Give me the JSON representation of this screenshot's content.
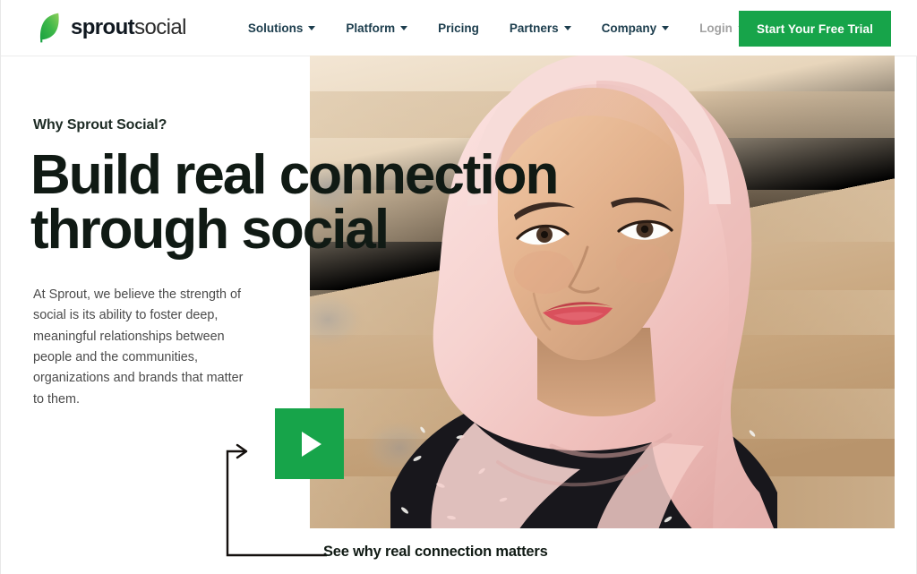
{
  "brand": {
    "name_bold": "sprout",
    "name_regular": "social",
    "logo_icon": "leaf-icon",
    "green": "#17a44a",
    "leaf_light": "#6cc24a",
    "leaf_dark": "#14a03f"
  },
  "nav": {
    "items": [
      {
        "label": "Solutions",
        "has_caret": true,
        "muted": false
      },
      {
        "label": "Platform",
        "has_caret": true,
        "muted": false
      },
      {
        "label": "Pricing",
        "has_caret": false,
        "muted": false
      },
      {
        "label": "Partners",
        "has_caret": true,
        "muted": false
      },
      {
        "label": "Company",
        "has_caret": true,
        "muted": false
      },
      {
        "label": "Login",
        "has_caret": true,
        "muted": true
      }
    ],
    "cta_label": "Start Your Free Trial"
  },
  "hero": {
    "eyebrow": "Why Sprout Social?",
    "headline": "Build real connection through social",
    "body": "At Sprout, we believe the strength of social is its ability to foster deep, meaningful relationships between people and the communities, organizations and brands that matter to them.",
    "image_alt": "Smiling woman wearing a pink hijab, warm blurred wooden background",
    "play_icon": "play-triangle-icon",
    "video_caption": "See why real connection matters",
    "connector_icon": "arrow-connector-icon"
  }
}
